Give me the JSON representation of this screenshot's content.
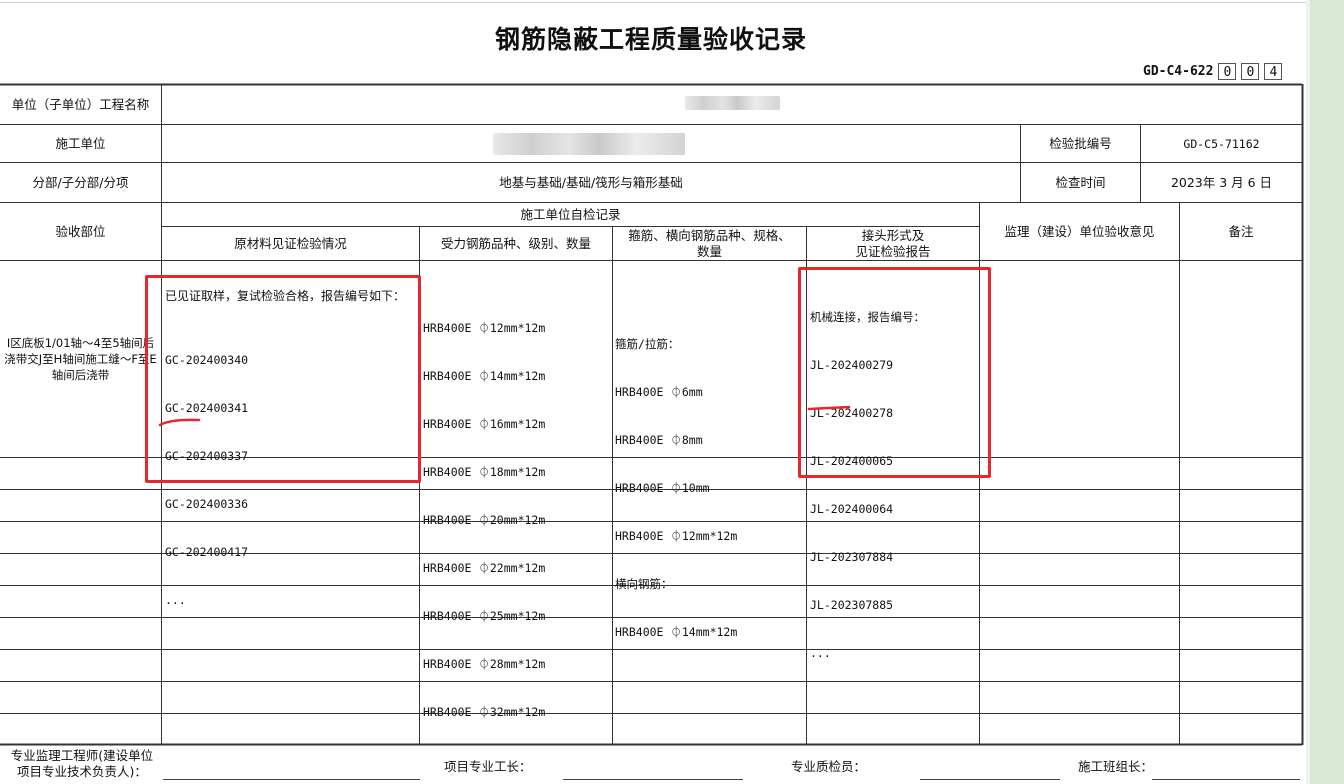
{
  "title": "钢筋隐蔽工程质量验收记录",
  "doc_code": {
    "prefix": "GD-C4-622",
    "boxes": [
      "0",
      "0",
      "4"
    ]
  },
  "rows": {
    "project_label": "单位（子单位）工程名称",
    "contractor_label": "施工单位",
    "batch_no_label": "检验批编号",
    "batch_no_value": "GD-C5-71162",
    "division_label": "分部/子分部/分项",
    "division_value": "地基与基础/基础/筏形与箱形基础",
    "check_time_label": "检查时间",
    "check_time_value": "2023年 3 月 6 日"
  },
  "headers": {
    "location": "验收部位",
    "self_check": "施工单位自检记录",
    "materials": "原材料见证检验情况",
    "main_rebar": "受力钢筋品种、级别、数量",
    "stirrup_line1": "箍筋、横向钢筋品种、规格、",
    "stirrup_line2": "数量",
    "joint_line1": "接头形式及",
    "joint_line2": "见证检验报告",
    "supervision": "监理（建设）单位验收意见",
    "remarks": "备注"
  },
  "entry": {
    "location": "Ⅰ区底板1/01轴～4至5轴间后浇带交J至H轴间施工缝～F至E轴间后浇带",
    "materials_intro": "已见证取样，复试检验合格，报告编号如下：",
    "materials_reports": [
      "GC-202400340",
      "GC-202400341",
      "GC-202400337",
      "GC-202400336",
      "GC-202400417",
      "..."
    ],
    "main_rebar": [
      "HRB400E ⏀12mm*12m",
      "HRB400E ⏀14mm*12m",
      "HRB400E ⏀16mm*12m",
      "HRB400E ⏀18mm*12m",
      "HRB400E ⏀20mm*12m",
      "HRB400E ⏀22mm*12m",
      "HRB400E ⏀25mm*12m",
      "HRB400E ⏀28mm*12m",
      "HRB400E ⏀32mm*12m"
    ],
    "stirrups": [
      "箍筋/拉筋：",
      "HRB400E ⏀6mm",
      "HRB400E ⏀8mm",
      "HRB400E ⏀10mm",
      "HRB400E ⏀12mm*12m",
      "横向钢筋：",
      "HRB400E ⏀14mm*12m"
    ],
    "joint": [
      "机械连接，报告编号：",
      "JL-202400279",
      "JL-202400278",
      "JL-202400065",
      "JL-202400064",
      "JL-202307884",
      "JL-202307885",
      "..."
    ]
  },
  "footer": {
    "engineer_line1": "专业监理工程师(建设单位",
    "engineer_line2": "项目专业技术负责人)：",
    "foreman": "项目专业工长：",
    "inspector": "专业质检员：",
    "team_leader": "施工班组长："
  },
  "colors": {
    "annotation": "#e8262b",
    "sidebar": "#d7e9d2"
  }
}
